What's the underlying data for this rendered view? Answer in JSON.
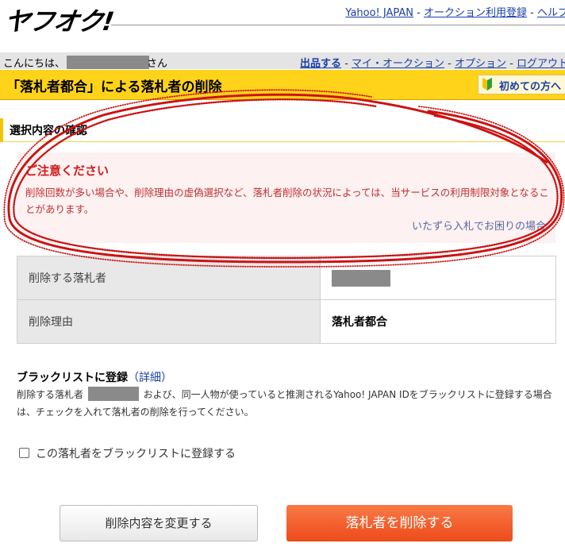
{
  "header": {
    "logo": "ヤフオク!",
    "links": [
      "Yahoo! JAPAN",
      "オークション利用登録",
      "ヘルプ"
    ],
    "separator": " - "
  },
  "greeting": {
    "prefix": "こんにちは、",
    "suffix": "さん"
  },
  "nav": {
    "links": [
      "出品する",
      "マイ・オークション",
      "オプション",
      "ログアウト"
    ]
  },
  "title": "「落札者都合」による落札者の削除",
  "beginner_link": "初めての方へ",
  "section_title": "選択内容の確認",
  "notice": {
    "title": "ご注意ください",
    "body": "削除回数が多い場合や、削除理由の虚偽選択など、落札者削除の状況によっては、当サービスの利用制限対象となることがあります。",
    "link": "いたずら入札でお困りの場合"
  },
  "table": {
    "rows": [
      {
        "label": "削除する落札者",
        "value": ""
      },
      {
        "label": "削除理由",
        "value": "落札者都合"
      }
    ]
  },
  "blacklist": {
    "title": "ブラックリストに登録",
    "detail_link": "（詳細）",
    "desc_prefix": "削除する落札者",
    "desc_suffix": "および、同一人物が使っていると推測されるYahoo! JAPAN IDをブラックリストに登録する場合は、チェックを入れて落札者の削除を行ってください。",
    "checkbox_label": "この落札者をブラックリストに登録する"
  },
  "buttons": {
    "change": "削除内容を変更する",
    "delete": "落札者を削除する"
  },
  "colors": {
    "title_bar": "#ffd31a",
    "notice_red": "#d01b1b",
    "delete_button": "#ee4a1a",
    "scribble": "#cc1111"
  }
}
